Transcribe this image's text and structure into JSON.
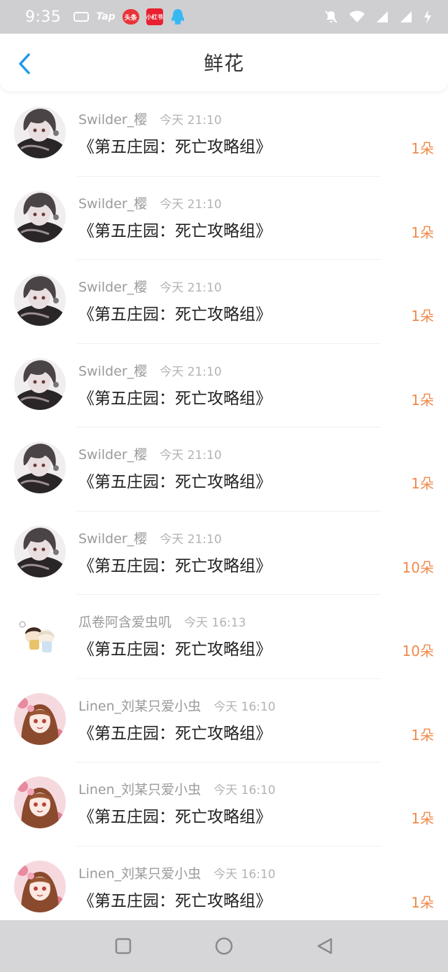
{
  "status_bar": {
    "time": "9:35",
    "tap_label": "Tap",
    "toutiao_label": "头条",
    "xiaohongshu_label": "小红书"
  },
  "header": {
    "title": "鲜花"
  },
  "colors": {
    "accent_blue": "#1e9be6",
    "amount_orange": "#f08a4b"
  },
  "rows": [
    {
      "user": "Swilder_樱",
      "time": "今天 21:10",
      "book": "《第五庄园：死亡攻略组》",
      "amount": "1朵",
      "avatar": "dark-hair-boy-avatar"
    },
    {
      "user": "Swilder_樱",
      "time": "今天 21:10",
      "book": "《第五庄园：死亡攻略组》",
      "amount": "1朵",
      "avatar": "dark-hair-boy-avatar"
    },
    {
      "user": "Swilder_樱",
      "time": "今天 21:10",
      "book": "《第五庄园：死亡攻略组》",
      "amount": "1朵",
      "avatar": "dark-hair-boy-avatar"
    },
    {
      "user": "Swilder_樱",
      "time": "今天 21:10",
      "book": "《第五庄园：死亡攻略组》",
      "amount": "1朵",
      "avatar": "dark-hair-boy-avatar"
    },
    {
      "user": "Swilder_樱",
      "time": "今天 21:10",
      "book": "《第五庄园：死亡攻略组》",
      "amount": "1朵",
      "avatar": "dark-hair-boy-avatar"
    },
    {
      "user": "Swilder_樱",
      "time": "今天 21:10",
      "book": "《第五庄园：死亡攻略组》",
      "amount": "10朵",
      "avatar": "dark-hair-boy-avatar"
    },
    {
      "user": "瓜卷阿含爱虫叽",
      "time": "今天 16:13",
      "book": "《第五庄园：死亡攻略组》",
      "amount": "10朵",
      "avatar": "chibi-pair-avatar"
    },
    {
      "user": "Linen_刘某只爱小虫",
      "time": "今天 16:10",
      "book": "《第五庄园：死亡攻略组》",
      "amount": "1朵",
      "avatar": "pink-girl-avatar"
    },
    {
      "user": "Linen_刘某只爱小虫",
      "time": "今天 16:10",
      "book": "《第五庄园：死亡攻略组》",
      "amount": "1朵",
      "avatar": "pink-girl-avatar"
    },
    {
      "user": "Linen_刘某只爱小虫",
      "time": "今天 16:10",
      "book": "《第五庄园：死亡攻略组》",
      "amount": "1朵",
      "avatar": "pink-girl-avatar"
    }
  ]
}
